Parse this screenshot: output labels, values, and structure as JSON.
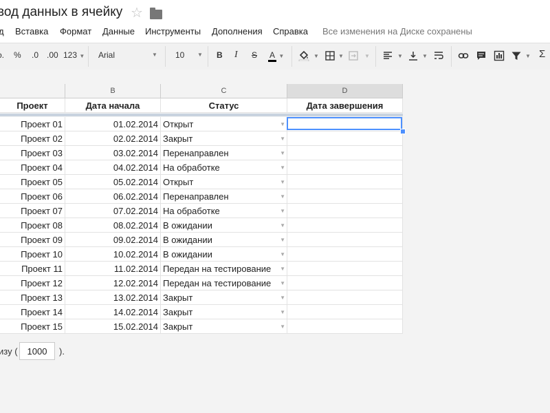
{
  "document": {
    "title": "вод данных в ячейку"
  },
  "menu": {
    "items": [
      "д",
      "Вставка",
      "Формат",
      "Данные",
      "Инструменты",
      "Дополнения",
      "Справка"
    ],
    "save_status": "Все изменения на Диске сохранены"
  },
  "toolbar": {
    "dot": "о.",
    "percent": "%",
    "dec_less": ".0",
    "dec_more": ".00",
    "more_formats": "123",
    "font": "Arial",
    "font_size": "10",
    "bold": "B",
    "italic": "I",
    "strike": "S",
    "text_color": "A",
    "text_color_value": "#000000",
    "sum": "Σ"
  },
  "sheet": {
    "columns": [
      "B",
      "C",
      "D"
    ],
    "selected_column": "D",
    "headers": [
      "Проект",
      "Дата начала",
      "Статус",
      "Дата завершения"
    ],
    "rows": [
      [
        "Проект 01",
        "01.02.2014",
        "Открыт",
        ""
      ],
      [
        "Проект 02",
        "02.02.2014",
        "Закрыт",
        ""
      ],
      [
        "Проект 03",
        "03.02.2014",
        "Перенаправлен",
        ""
      ],
      [
        "Проект 04",
        "04.02.2014",
        "На обработке",
        ""
      ],
      [
        "Проект 05",
        "05.02.2014",
        "Открыт",
        ""
      ],
      [
        "Проект 06",
        "06.02.2014",
        "Перенаправлен",
        ""
      ],
      [
        "Проект 07",
        "07.02.2014",
        "На обработке",
        ""
      ],
      [
        "Проект 08",
        "08.02.2014",
        "В ожидании",
        ""
      ],
      [
        "Проект 09",
        "09.02.2014",
        "В ожидании",
        ""
      ],
      [
        "Проект 10",
        "10.02.2014",
        "В ожидании",
        ""
      ],
      [
        "Проект 11",
        "11.02.2014",
        "Передан на тестирование",
        ""
      ],
      [
        "Проект 12",
        "12.02.2014",
        "Передан на тестирование",
        ""
      ],
      [
        "Проект 13",
        "13.02.2014",
        "Закрыт",
        ""
      ],
      [
        "Проект 14",
        "14.02.2014",
        "Закрыт",
        ""
      ],
      [
        "Проект 15",
        "15.02.2014",
        "Закрыт",
        ""
      ]
    ]
  },
  "footer": {
    "prefix": "изу (",
    "rows_value": "1000",
    "suffix": ")."
  },
  "colors": {
    "accent": "#4d90fe",
    "freeze_bar": "#c8d3df"
  }
}
